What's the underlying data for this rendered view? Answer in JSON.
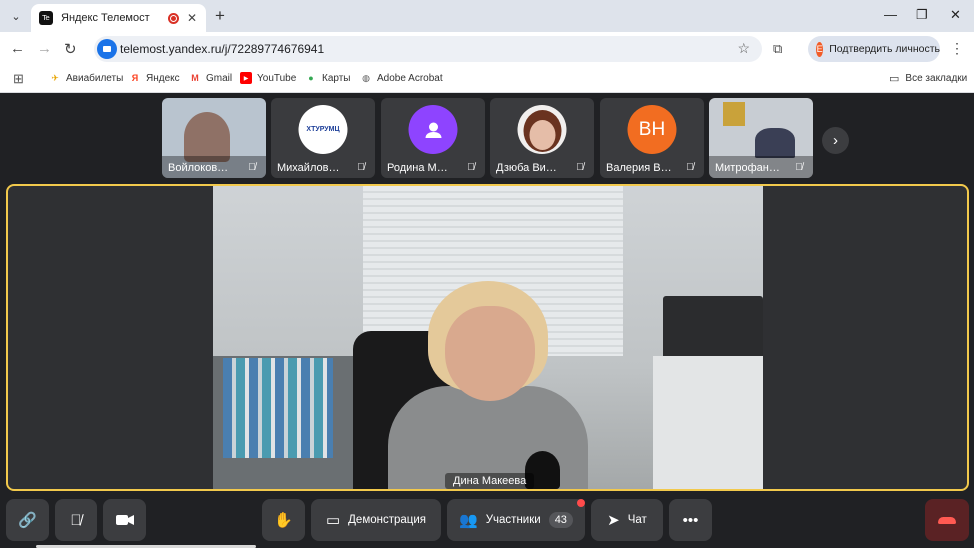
{
  "browser": {
    "tab_title": "Яндекс Телемост",
    "tab_favicon": "Te",
    "url": "telemost.yandex.ru/j/72289774676941",
    "verify_label": "Подтвердить личность",
    "verify_badge": "E",
    "all_bookmarks": "Все закладки",
    "bookmarks": [
      {
        "label": "Авиабилеты",
        "icon": "plane-icon",
        "color": "#e8a400"
      },
      {
        "label": "Яндекс",
        "icon": "yandex-icon",
        "color": "#fc3f1d"
      },
      {
        "label": "Gmail",
        "icon": "gmail-icon",
        "color": "#ea4335"
      },
      {
        "label": "YouTube",
        "icon": "youtube-icon",
        "color": "#ff0000"
      },
      {
        "label": "Карты",
        "icon": "maps-icon",
        "color": "#34a853"
      },
      {
        "label": "Adobe Acrobat",
        "icon": "globe-icon",
        "color": "#555555"
      }
    ]
  },
  "participants": [
    {
      "name": "Войлоков…",
      "type": "video"
    },
    {
      "name": "Михайлов…",
      "type": "logo",
      "logo_text": "ХТУРУМЦ"
    },
    {
      "name": "Родина М…",
      "type": "avatar-icon",
      "color": "#8e44ff"
    },
    {
      "name": "Дзюба Ви…",
      "type": "photo"
    },
    {
      "name": "Валерия В…",
      "type": "initials",
      "initials": "ВН",
      "color": "#f26d21"
    },
    {
      "name": "Митрофан…",
      "type": "video"
    }
  ],
  "speaker": {
    "name": "Дина Макеева"
  },
  "toolbar": {
    "share_label": "Демонстрация",
    "participants_label": "Участники",
    "participants_count": "43",
    "chat_label": "Чат"
  },
  "colors": {
    "active_speaker_border": "#f2c94c",
    "hangup": "#ff5a52",
    "notification_dot": "#ff4b4b"
  }
}
